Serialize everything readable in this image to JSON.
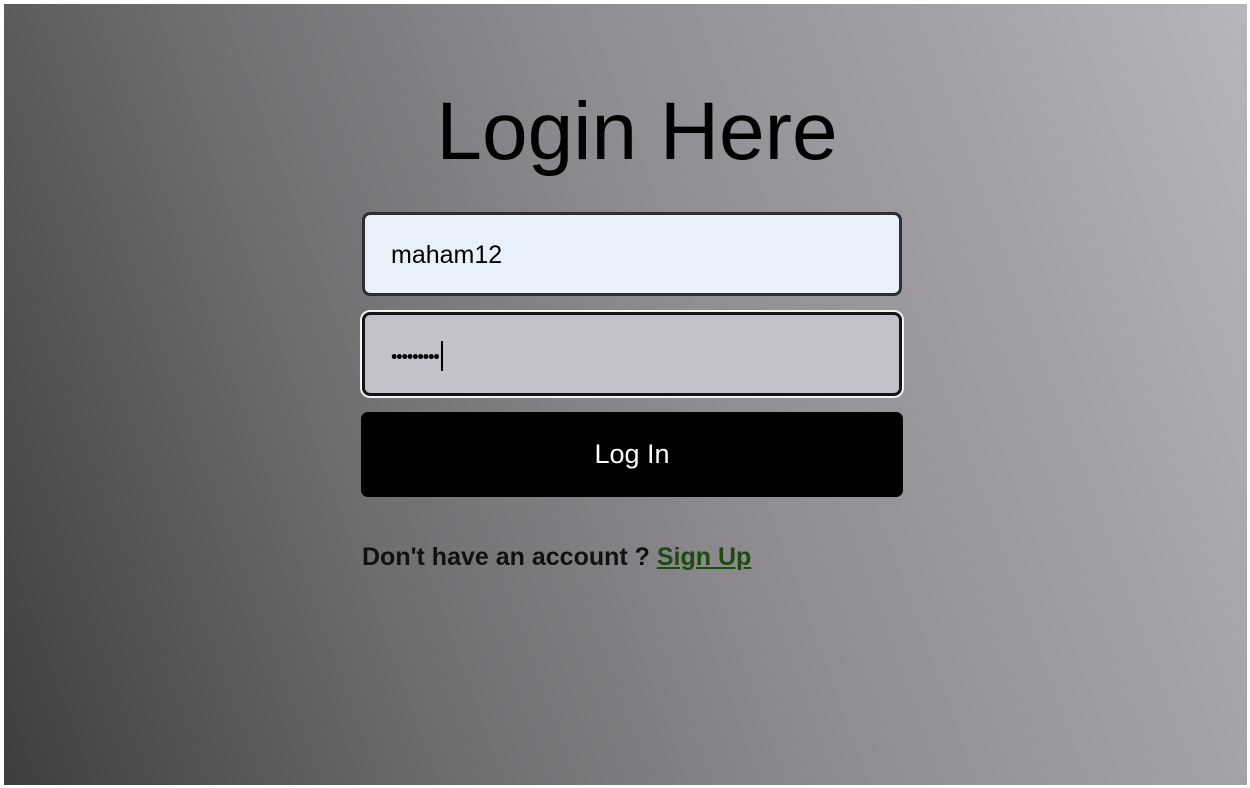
{
  "login": {
    "title": "Login Here",
    "username_value": "maham12",
    "password_masked": "•••••••••",
    "login_button_label": "Log In",
    "signup_prompt": "Don't have an account ? ",
    "signup_link_label": "Sign Up"
  },
  "colors": {
    "button_background": "#000000",
    "username_field_background": "#e8f0fb",
    "password_field_background": "#c3c1c9",
    "link_color": "#1c4a10"
  }
}
